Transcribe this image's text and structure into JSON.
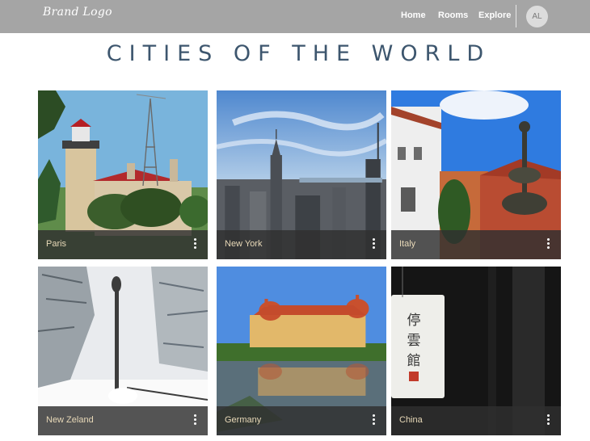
{
  "header": {
    "brand": "Brand Logo",
    "nav": {
      "home": "Home",
      "rooms": "Rooms",
      "explore": "Explore"
    },
    "avatar_initials": "AL"
  },
  "page": {
    "title": "CITIES OF THE WORLD"
  },
  "cards": [
    {
      "label": "Paris",
      "menu_icon": "more-vert-icon"
    },
    {
      "label": "New York",
      "menu_icon": "more-vert-icon"
    },
    {
      "label": "Italy",
      "menu_icon": "more-vert-icon"
    },
    {
      "label": "New Zeland",
      "menu_icon": "more-vert-icon"
    },
    {
      "label": "Germany",
      "menu_icon": "more-vert-icon"
    },
    {
      "label": "China",
      "menu_icon": "more-vert-icon"
    }
  ],
  "colors": {
    "navbar": "#a5a5a5",
    "title": "#3d566e",
    "caption_text": "#e8d9b8"
  }
}
